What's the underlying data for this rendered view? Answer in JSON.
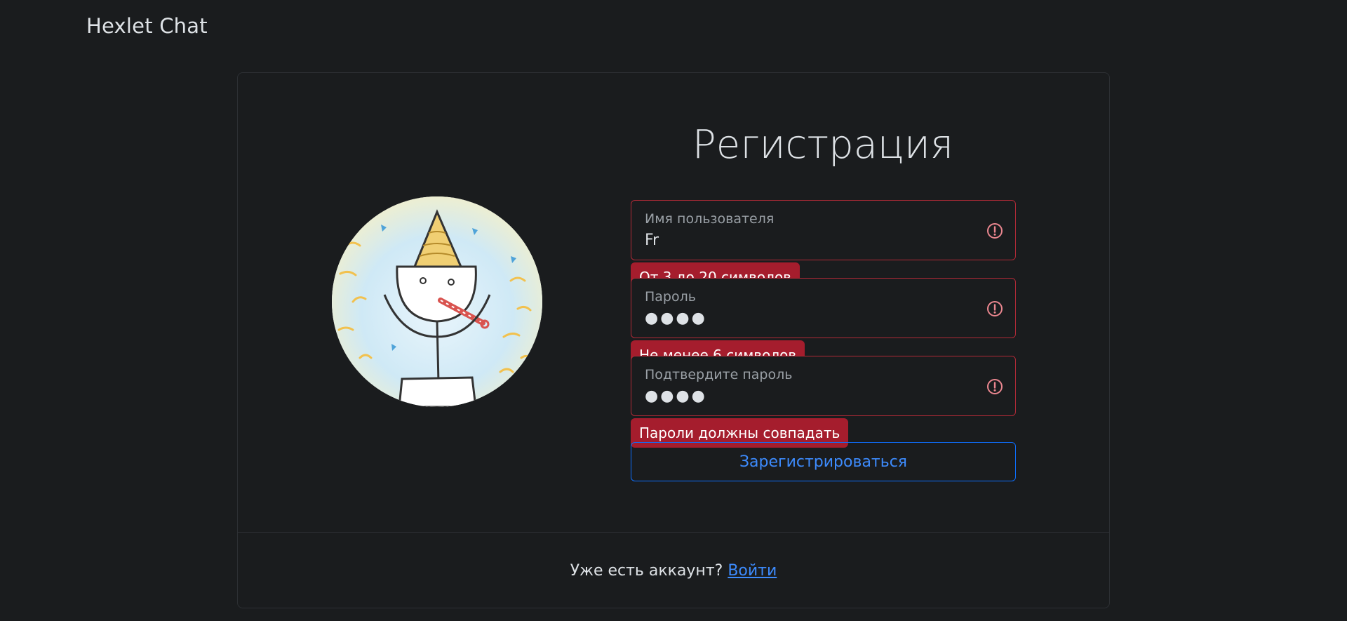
{
  "navbar": {
    "brand": "Hexlet Chat"
  },
  "form": {
    "title": "Регистрация",
    "fields": [
      {
        "label": "Имя пользователя",
        "value": "Fr",
        "error": "От 3 до 20 символов"
      },
      {
        "label": "Пароль",
        "value": "●●●●",
        "error": "Не менее 6 символов"
      },
      {
        "label": "Подтвердите пароль",
        "value": "●●●●",
        "error": "Пароли должны совпадать"
      }
    ],
    "submit_label": "Зарегистрироваться"
  },
  "footer": {
    "text": "Уже есть аккаунт?",
    "link_label": "Войти"
  },
  "icons": {
    "invalid": "exclamation-circle-icon",
    "avatar": "party-stick-figure-illustration"
  },
  "colors": {
    "background": "#1a1c1e",
    "danger": "#a51d2d",
    "primary": "#0d6efd",
    "link": "#3d8bfd"
  }
}
